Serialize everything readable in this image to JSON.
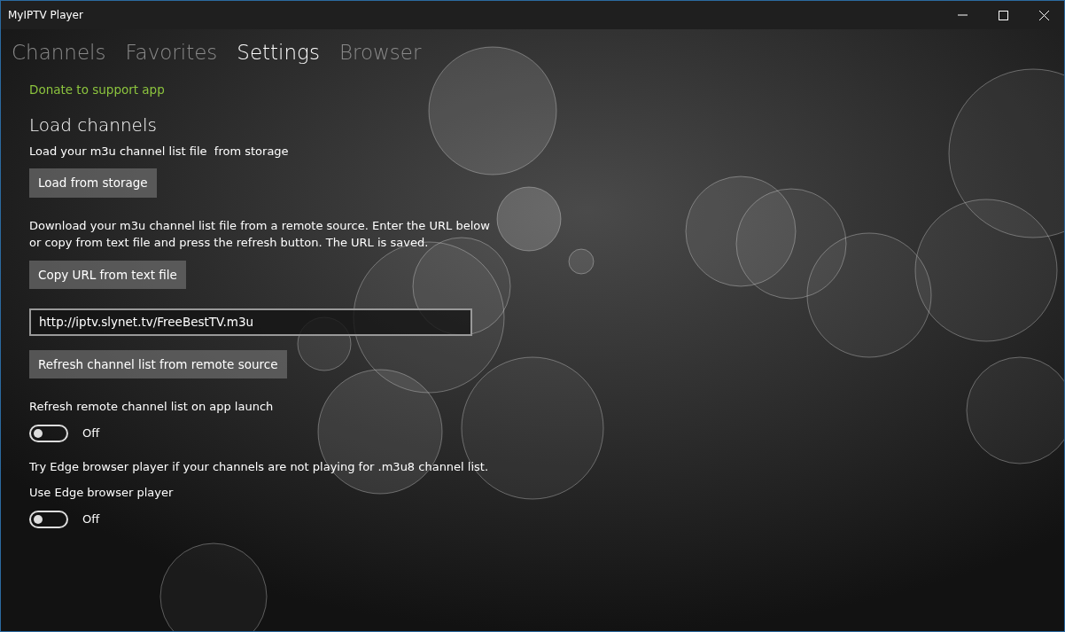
{
  "window": {
    "title": "MyIPTV Player"
  },
  "tabs": [
    {
      "label": "Channels",
      "selected": false
    },
    {
      "label": "Favorites",
      "selected": false
    },
    {
      "label": "Settings",
      "selected": true
    },
    {
      "label": "Browser",
      "selected": false
    }
  ],
  "settings": [
    {
      "kind": "link",
      "text": "Donate to support app"
    },
    {
      "kind": "heading",
      "text": "Load channels"
    },
    {
      "kind": "text",
      "text": "Load your m3u channel list file  from storage"
    },
    {
      "kind": "button",
      "text": "Load from storage"
    },
    {
      "kind": "text",
      "text": "Download your m3u channel list file from a remote source. Enter the URL below  or copy from text file and press the refresh button. The URL is saved."
    },
    {
      "kind": "button",
      "text": "Copy URL from text file"
    },
    {
      "kind": "field",
      "value": "http://iptv.slynet.tv/FreeBestTV.m3u"
    },
    {
      "kind": "button",
      "text": "Refresh channel list from remote source"
    },
    {
      "kind": "text",
      "text": "Refresh remote channel list on app launch"
    },
    {
      "kind": "toggle",
      "on": false,
      "state_label": "Off"
    },
    {
      "kind": "text",
      "text": "Try Edge browser player if your channels are not playing for .m3u8 channel list."
    },
    {
      "kind": "text",
      "text": "Use Edge browser player"
    },
    {
      "kind": "toggle",
      "on": false,
      "state_label": "Off"
    }
  ]
}
